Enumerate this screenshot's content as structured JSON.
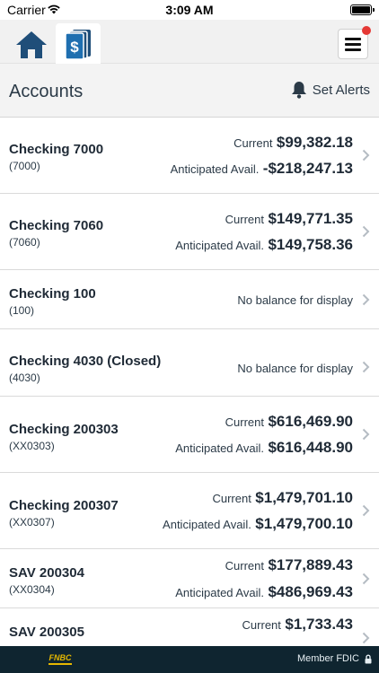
{
  "status_bar": {
    "carrier": "Carrier",
    "time": "3:09 AM",
    "battery_level": 1.0
  },
  "nav": {
    "home_icon": "home-icon",
    "accounts_icon": "dollar-card-icon",
    "menu_icon": "hamburger-menu-icon",
    "menu_badge_color": "#e53935"
  },
  "header": {
    "title": "Accounts",
    "alerts_label": "Set Alerts",
    "alerts_icon": "bell-icon"
  },
  "accounts": [
    {
      "name": "Checking 7000",
      "sub": "(7000)",
      "current_label": "Current",
      "current_value": "$99,382.18",
      "avail_label": "Anticipated Avail.",
      "avail_value": "-$218,247.13"
    },
    {
      "name": "Checking 7060",
      "sub": "(7060)",
      "current_label": "Current",
      "current_value": "$149,771.35",
      "avail_label": "Anticipated Avail.",
      "avail_value": "$149,758.36"
    },
    {
      "name": "Checking 100",
      "sub": "(100)",
      "no_balance": "No balance for display"
    },
    {
      "name": "Checking 4030 (Closed)",
      "sub": "(4030)",
      "no_balance": "No balance for display"
    },
    {
      "name": "Checking 200303",
      "sub": "(XX0303)",
      "current_label": "Current",
      "current_value": "$616,469.90",
      "avail_label": "Anticipated Avail.",
      "avail_value": "$616,448.90"
    },
    {
      "name": "Checking 200307",
      "sub": "(XX0307)",
      "current_label": "Current",
      "current_value": "$1,479,701.10",
      "avail_label": "Anticipated Avail.",
      "avail_value": "$1,479,700.10"
    },
    {
      "name": "SAV 200304",
      "sub": "(XX0304)",
      "current_label": "Current",
      "current_value": "$177,889.43",
      "avail_label": "Anticipated Avail.",
      "avail_value": "$486,969.43"
    },
    {
      "name": "SAV 200305",
      "current_label": "Current",
      "current_value": "$1,733.43"
    }
  ],
  "footer": {
    "logo_text": "FNBC",
    "member_text": "Member FDIC",
    "lock_icon": "lock-icon"
  },
  "colors": {
    "footer_bg": "#0f2530",
    "navy": "#1f4e79",
    "logo_gold": "#e6b800"
  }
}
